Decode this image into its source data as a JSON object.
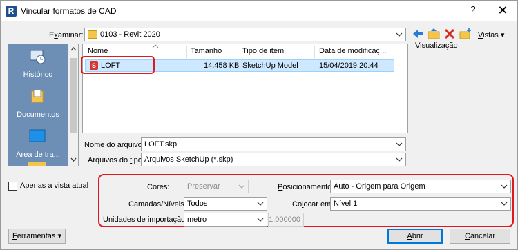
{
  "window": {
    "title": "Vincular formatos de CAD",
    "help_label": "?",
    "close_label": "✕"
  },
  "lookin": {
    "label_pre": "E",
    "label_u": "x",
    "label_post": "aminar:",
    "value": "0103 - Revit 2020"
  },
  "toolbar": {
    "icons": [
      "back-arrow-icon",
      "folder-up-icon",
      "delete-icon",
      "new-folder-icon"
    ],
    "views_label_u": "V",
    "views_label_post": "istas",
    "preview_label": "Visualização"
  },
  "places": [
    {
      "label": "Histórico",
      "icon": "history-icon"
    },
    {
      "label": "Documentos",
      "icon": "documents-icon"
    },
    {
      "label": "Área de tra...",
      "icon": "desktop-icon"
    }
  ],
  "filelist": {
    "columns": [
      "Nome",
      "Tamanho",
      "Tipo de item",
      "Data de modificaç..."
    ],
    "rows": [
      {
        "name": "LOFT",
        "size": "14.458 KB",
        "type": "SketchUp Model",
        "date": "15/04/2019 20:44"
      }
    ]
  },
  "filename": {
    "label_pre": "",
    "label_u": "N",
    "label_post": "ome do arquivo:",
    "value": "LOFT.skp"
  },
  "filetype": {
    "label_pre": "Arquivos do ",
    "label_u": "t",
    "label_post": "ipo:",
    "value": "Arquivos SketchUp  (*.skp)"
  },
  "current_view_only": {
    "label_pre": "Apenas a vista a",
    "label_u": "t",
    "label_post": "ual",
    "checked": false
  },
  "options": {
    "colors": {
      "label": "Cores:",
      "value": "Preservar"
    },
    "layers": {
      "label": "Camadas/Níveis:",
      "value": "Todos"
    },
    "units": {
      "label": "Unidades de importação:",
      "value": "metro",
      "factor": "1.000000"
    },
    "positioning": {
      "label_pre": "",
      "label_u": "P",
      "label_post": "osicionamento:",
      "value": "Auto - Origem para Origem"
    },
    "place_at": {
      "label_pre": "Co",
      "label_u": "l",
      "label_post": "ocar em:",
      "value": "Nível 1"
    }
  },
  "buttons": {
    "tools_u": "F",
    "tools_post": "erramentas",
    "open_u": "A",
    "open_post": "brir",
    "cancel_u": "C",
    "cancel_post": "ancelar"
  },
  "colors": {
    "highlight": "#e0191e",
    "selection": "#cde8ff",
    "places_bg": "#6e8fb5"
  }
}
